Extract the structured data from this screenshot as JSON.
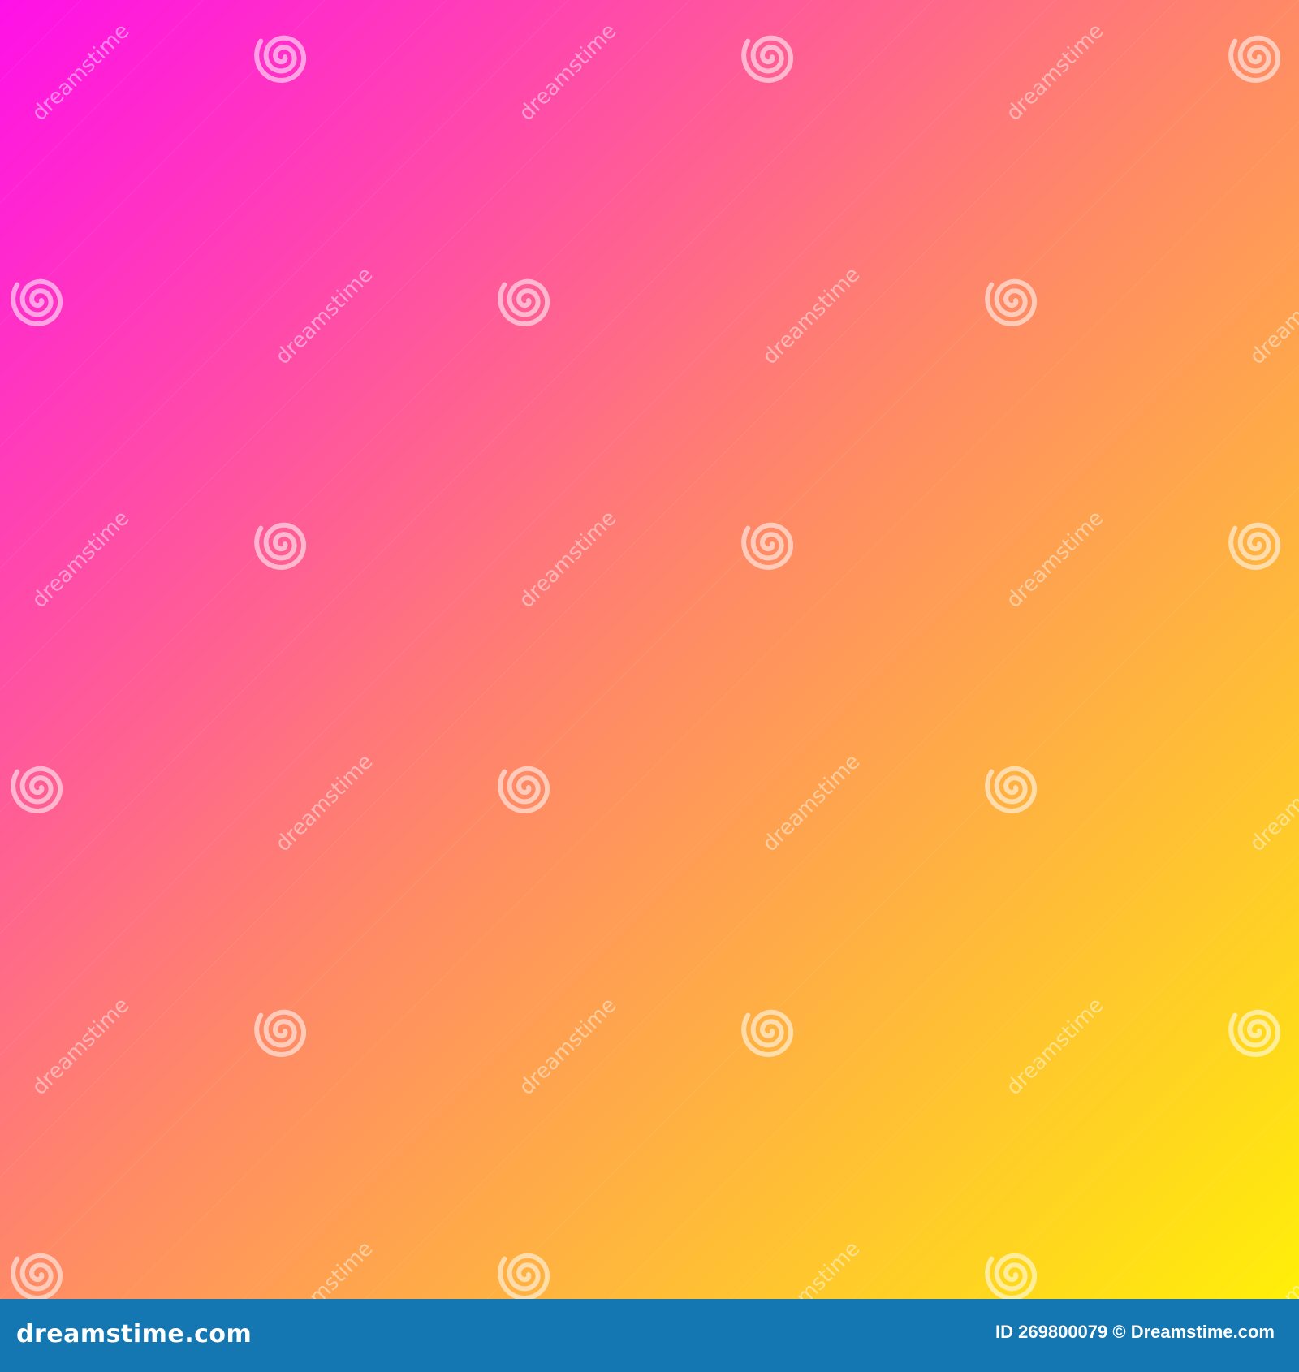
{
  "image": {
    "colors": {
      "gradient_start": "#ff10e8",
      "gradient_mid": "#ff8a66",
      "gradient_end": "#ffef08",
      "footer_background": "#1577b2",
      "footer_text": "#ffffff"
    },
    "watermark": {
      "text": "dreamstime",
      "icon": "spiral-icon"
    }
  },
  "footer": {
    "brand": "dreamstime.com",
    "credit": "ID 269800079 © Dreamstime.com"
  }
}
